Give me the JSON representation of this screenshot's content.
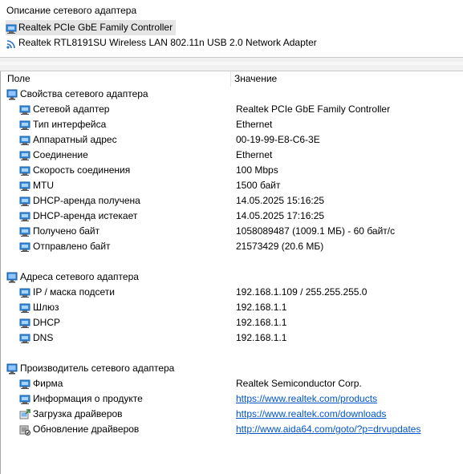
{
  "top": {
    "title": "Описание сетевого адаптера",
    "adapters": [
      {
        "label": "Realtek PCIe GbE Family Controller",
        "icon": "network-card-icon",
        "selected": true
      },
      {
        "label": "Realtek RTL8191SU Wireless LAN 802.11n USB 2.0 Network Adapter",
        "icon": "wifi-icon",
        "selected": false
      }
    ]
  },
  "columns": {
    "field": "Поле",
    "value": "Значение"
  },
  "groups": [
    {
      "title": "Свойства сетевого адаптера",
      "items": [
        {
          "field": "Сетевой адаптер",
          "value": "Realtek PCIe GbE Family Controller"
        },
        {
          "field": "Тип интерфейса",
          "value": "Ethernet"
        },
        {
          "field": "Аппаратный адрес",
          "value": "00-19-99-E8-C6-3E"
        },
        {
          "field": "Соединение",
          "value": "Ethernet"
        },
        {
          "field": "Скорость соединения",
          "value": "100 Mbps"
        },
        {
          "field": "MTU",
          "value": "1500 байт"
        },
        {
          "field": "DHCP-аренда получена",
          "value": "14.05.2025 15:16:25"
        },
        {
          "field": "DHCP-аренда истекает",
          "value": "14.05.2025 17:16:25"
        },
        {
          "field": "Получено байт",
          "value": "1058089487 (1009.1 МБ) - 60 байт/с"
        },
        {
          "field": "Отправлено байт",
          "value": "21573429 (20.6 МБ)"
        }
      ]
    },
    {
      "title": "Адреса сетевого адаптера",
      "items": [
        {
          "field": "IP / маска подсети",
          "value": "192.168.1.109 / 255.255.255.0"
        },
        {
          "field": "Шлюз",
          "value": "192.168.1.1"
        },
        {
          "field": "DHCP",
          "value": "192.168.1.1"
        },
        {
          "field": "DNS",
          "value": "192.168.1.1"
        }
      ]
    },
    {
      "title": "Производитель сетевого адаптера",
      "items": [
        {
          "field": "Фирма",
          "value": "Realtek Semiconductor Corp.",
          "icon": "network-card-icon"
        },
        {
          "field": "Информация о продукте",
          "value": "https://www.realtek.com/products",
          "link": true,
          "icon": "network-card-icon"
        },
        {
          "field": "Загрузка драйверов",
          "value": "https://www.realtek.com/downloads",
          "link": true,
          "icon": "driver-download-icon"
        },
        {
          "field": "Обновление драйверов",
          "value": "http://www.aida64.com/goto/?p=drvupdates",
          "link": true,
          "icon": "driver-update-icon"
        }
      ]
    }
  ],
  "colors": {
    "link": "#0055cc",
    "selection": "#e5e5e5",
    "icon_blue": "#2f7fd0"
  }
}
